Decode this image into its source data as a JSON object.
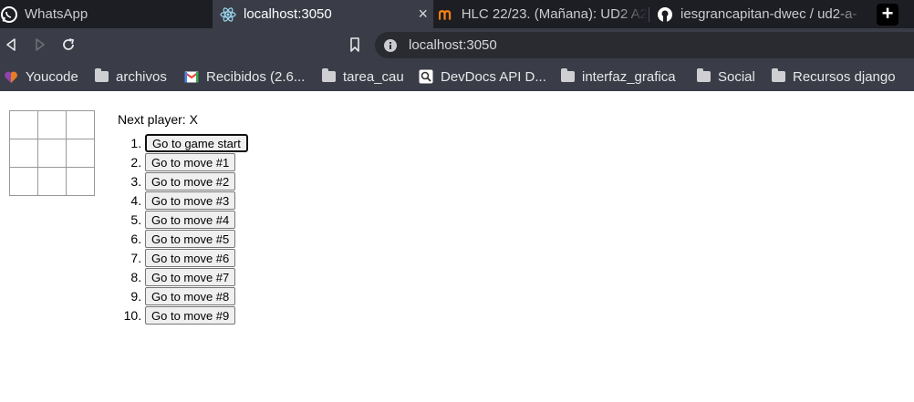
{
  "browser": {
    "tabs": [
      {
        "label": "WhatsApp"
      },
      {
        "label": "localhost:3050"
      },
      {
        "label": "HLC 22/23. (Mañana): UD2 A2"
      },
      {
        "label": "iesgrancapitan-dwec / ud2-a-"
      }
    ],
    "close_glyph": "×",
    "new_tab_glyph": "+",
    "url": "localhost:3050",
    "bookmarks": [
      {
        "label": "Youcode"
      },
      {
        "label": "archivos"
      },
      {
        "label": "Recibidos (2.6..."
      },
      {
        "label": "tarea_cau"
      },
      {
        "label": "DevDocs API D..."
      },
      {
        "label": "interfaz_grafica"
      },
      {
        "label": "Social"
      },
      {
        "label": "Recursos django"
      }
    ],
    "colors": {
      "chrome_dark": "#1d1e23",
      "chrome": "#3a3d47",
      "whatsapp": "#25d366",
      "gmail_red": "#ea4335",
      "moodle": "#f98012"
    }
  },
  "game": {
    "status": "Next player: X",
    "squares": [
      "",
      "",
      "",
      "",
      "",
      "",
      "",
      "",
      ""
    ],
    "moves": [
      {
        "number": "1.",
        "label": "Go to game start"
      },
      {
        "number": "2.",
        "label": "Go to move #1"
      },
      {
        "number": "3.",
        "label": "Go to move #2"
      },
      {
        "number": "4.",
        "label": "Go to move #3"
      },
      {
        "number": "5.",
        "label": "Go to move #4"
      },
      {
        "number": "6.",
        "label": "Go to move #5"
      },
      {
        "number": "7.",
        "label": "Go to move #6"
      },
      {
        "number": "8.",
        "label": "Go to move #7"
      },
      {
        "number": "9.",
        "label": "Go to move #8"
      },
      {
        "number": "10.",
        "label": "Go to move #9"
      }
    ]
  }
}
